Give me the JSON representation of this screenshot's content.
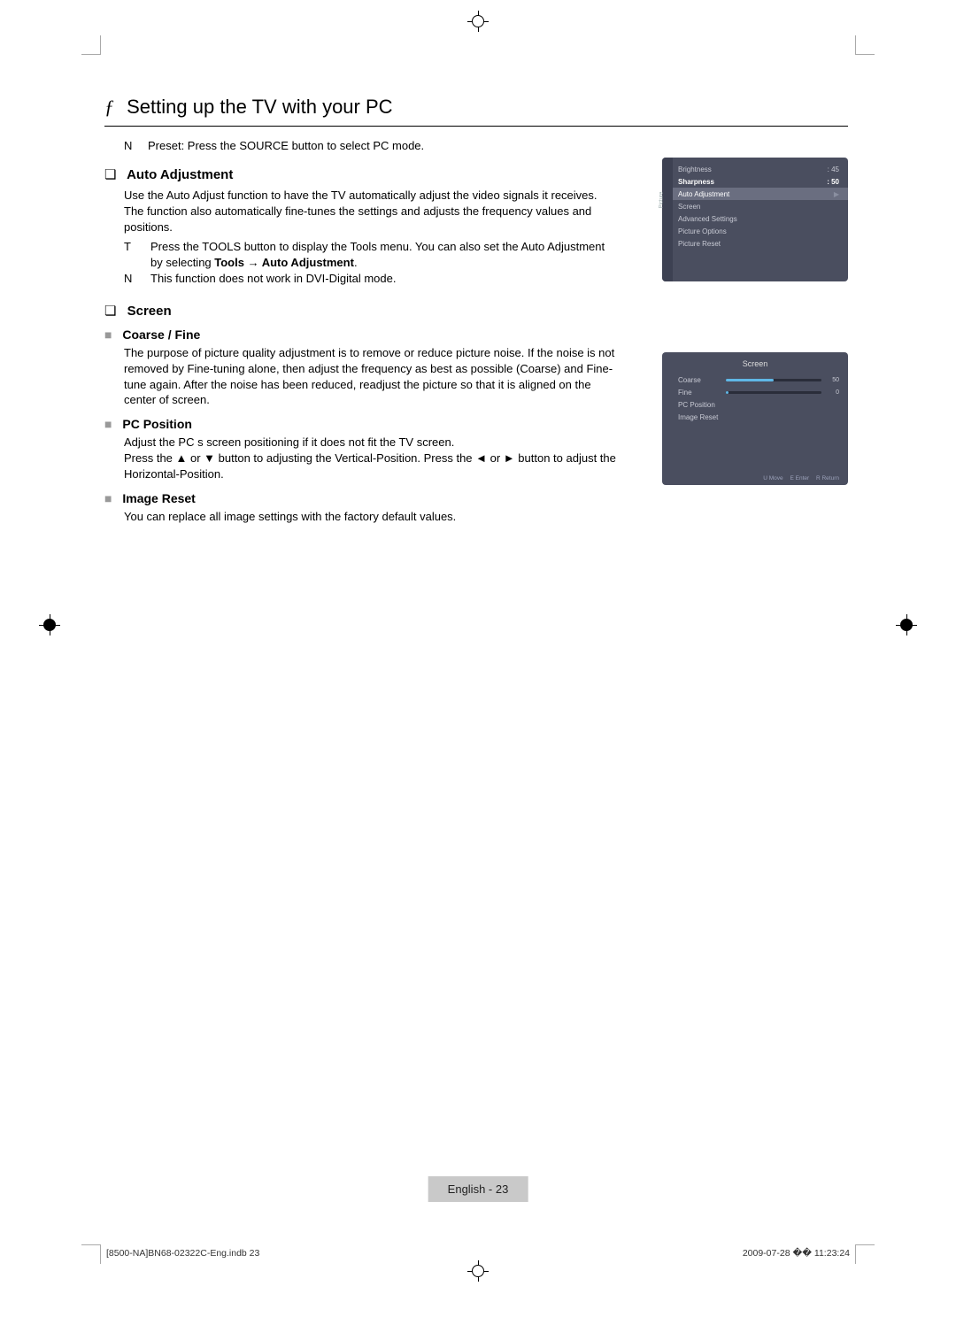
{
  "title_icon": "ƒ",
  "title": "Setting up the TV with your PC",
  "preset": {
    "marker": "N",
    "text": "Preset: Press the SOURCE button to select PC mode."
  },
  "auto_adjustment": {
    "heading": "Auto Adjustment",
    "body": "Use the Auto Adjust function to have the TV automatically adjust the video signals it receives. The function also automatically fine-tunes the settings and adjusts the frequency values and positions.",
    "bullets": [
      {
        "marker": "T",
        "text_pre": "Press the TOOLS button to display the Tools menu. You can also set the Auto Adjustment by selecting ",
        "bold": "Tools → Auto Adjustment",
        "text_post": "."
      },
      {
        "marker": "N",
        "text": "This function does not work in DVI-Digital mode."
      }
    ]
  },
  "screen": {
    "heading": "Screen",
    "coarse_fine": {
      "heading": "Coarse / Fine",
      "body": "The purpose of picture quality adjustment is to remove or reduce picture noise. If the noise is not removed by Fine-tuning alone, then adjust the frequency as best as possible (Coarse) and Fine-tune again. After the noise has been reduced, readjust the picture so that it is aligned on the center of screen."
    },
    "pc_position": {
      "heading": "PC Position",
      "line1": "Adjust the PC s screen positioning if it does not fit the TV screen.",
      "line2": "Press the ▲ or ▼ button to adjusting the Vertical-Position. Press the ◄ or ► button to adjust the Horizontal-Position."
    },
    "image_reset": {
      "heading": "Image Reset",
      "body": "You can replace all image settings with the factory default values."
    }
  },
  "osd1": {
    "sidebar": "Picture",
    "rows": [
      {
        "label": "Brightness",
        "value": ": 45"
      },
      {
        "label": "Sharpness",
        "value": ": 50",
        "hl": true
      },
      {
        "label": "Auto Adjustment",
        "value": "",
        "sel": true,
        "arrow": "▶"
      },
      {
        "label": "Screen",
        "value": ""
      },
      {
        "label": "Advanced Settings",
        "value": ""
      },
      {
        "label": "Picture Options",
        "value": ""
      },
      {
        "label": "Picture Reset",
        "value": ""
      }
    ]
  },
  "osd2": {
    "title": "Screen",
    "rows": [
      {
        "label": "Coarse",
        "val": "50",
        "fill": "half"
      },
      {
        "label": "Fine",
        "val": "0",
        "fill": "low"
      },
      {
        "label": "PC Position"
      },
      {
        "label": "Image Reset"
      }
    ],
    "footer": {
      "move": "U Move",
      "enter": "E Enter",
      "ret": "R Return"
    }
  },
  "page_footer": {
    "lang": "English - ",
    "num": "23"
  },
  "doc_footer_left": "[8500-NA]BN68-02322C-Eng.indb   23",
  "doc_footer_right": "2009-07-28   �� 11:23:24"
}
